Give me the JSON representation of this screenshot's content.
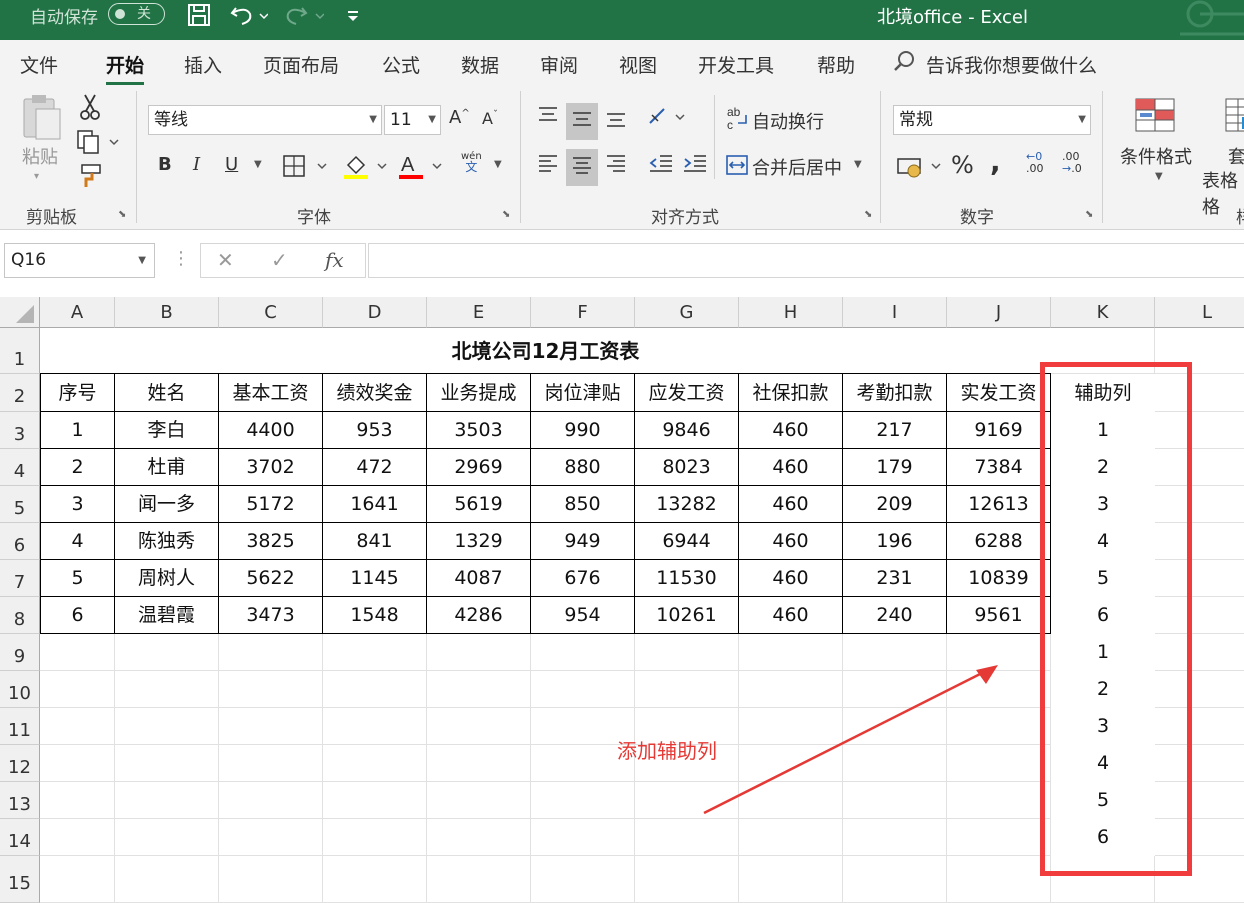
{
  "titlebar": {
    "autosave_label": "自动保存",
    "autosave_state": "关",
    "doc_title": "北境office  -  Excel"
  },
  "menu": {
    "tabs": [
      "文件",
      "开始",
      "插入",
      "页面布局",
      "公式",
      "数据",
      "审阅",
      "视图",
      "开发工具",
      "帮助"
    ],
    "active": "开始",
    "tell_me": "告诉我你想要做什么"
  },
  "ribbon": {
    "clipboard": {
      "paste": "粘贴",
      "label": "剪贴板"
    },
    "font": {
      "name": "等线",
      "size": "11",
      "label": "字体",
      "grow": "A",
      "shrink": "A",
      "bold": "B",
      "italic": "I",
      "underline": "U",
      "color_letter": "A",
      "phonetic_top": "wén",
      "phonetic_bottom": "文"
    },
    "alignment": {
      "wrap_text": "自动换行",
      "merge_center": "合并后居中",
      "label": "对齐方式"
    },
    "number": {
      "format": "常规",
      "percent": "%",
      "comma": ",",
      "inc_decimal": ".00",
      "dec_decimal": ".0",
      "label": "数字"
    },
    "styles": {
      "conditional": "条件格式",
      "format_table_top": "套",
      "format_table_bottom": "表格格",
      "label_partial": "样"
    }
  },
  "formula_bar": {
    "name_box": "Q16",
    "fx": "fx",
    "formula": ""
  },
  "sheet": {
    "columns": [
      "A",
      "B",
      "C",
      "D",
      "E",
      "F",
      "G",
      "H",
      "I",
      "J",
      "K",
      "L"
    ],
    "rows": [
      "1",
      "2",
      "3",
      "4",
      "5",
      "6",
      "7",
      "8",
      "9",
      "10",
      "11",
      "12",
      "13",
      "14",
      "15"
    ],
    "title": "北境公司12月工资表",
    "headers": [
      "序号",
      "姓名",
      "基本工资",
      "绩效奖金",
      "业务提成",
      "岗位津贴",
      "应发工资",
      "社保扣款",
      "考勤扣款",
      "实发工资"
    ],
    "data": [
      [
        "1",
        "李白",
        "4400",
        "953",
        "3503",
        "990",
        "9846",
        "460",
        "217",
        "9169"
      ],
      [
        "2",
        "杜甫",
        "3702",
        "472",
        "2969",
        "880",
        "8023",
        "460",
        "179",
        "7384"
      ],
      [
        "3",
        "闻一多",
        "5172",
        "1641",
        "5619",
        "850",
        "13282",
        "460",
        "209",
        "12613"
      ],
      [
        "4",
        "陈独秀",
        "3825",
        "841",
        "1329",
        "949",
        "6944",
        "460",
        "196",
        "6288"
      ],
      [
        "5",
        "周树人",
        "5622",
        "1145",
        "4087",
        "676",
        "11530",
        "460",
        "231",
        "10839"
      ],
      [
        "6",
        "温碧霞",
        "3473",
        "1548",
        "4286",
        "954",
        "10261",
        "460",
        "240",
        "9561"
      ]
    ],
    "helper_header": "辅助列",
    "helper_values": [
      "1",
      "2",
      "3",
      "4",
      "5",
      "6",
      "1",
      "2",
      "3",
      "4",
      "5",
      "6"
    ]
  },
  "annotation": {
    "text": "添加辅助列",
    "color": "#e53935"
  },
  "colors": {
    "excel_green": "#217346",
    "highlight_yellow": "#ffff00",
    "font_red": "#ff0000",
    "box_red": "#f03c3c"
  }
}
